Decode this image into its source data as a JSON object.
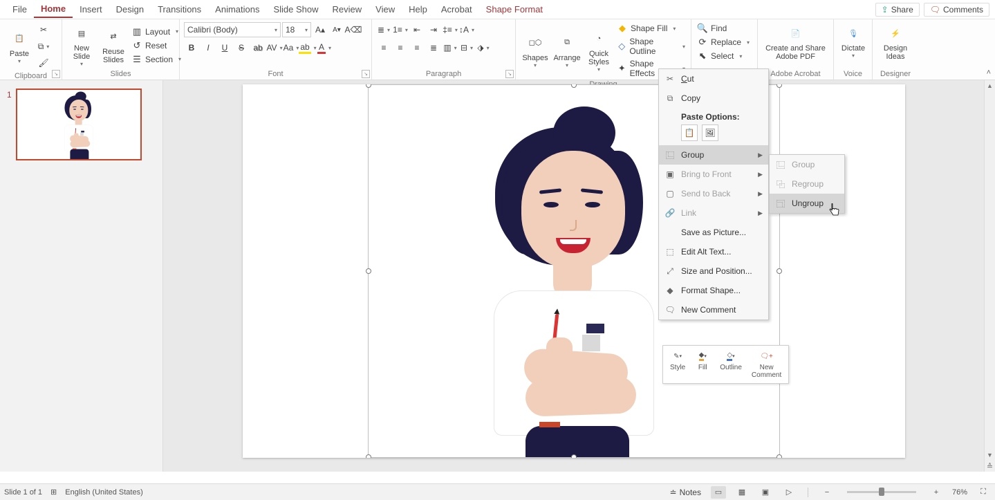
{
  "tabs": {
    "items": [
      "File",
      "Home",
      "Insert",
      "Design",
      "Transitions",
      "Animations",
      "Slide Show",
      "Review",
      "View",
      "Help",
      "Acrobat"
    ],
    "active": "Home",
    "context": "Shape Format"
  },
  "topbuttons": {
    "share": "Share",
    "comments": "Comments"
  },
  "ribbon": {
    "clipboard": {
      "label": "Clipboard",
      "paste": "Paste"
    },
    "slides": {
      "label": "Slides",
      "new": "New\nSlide",
      "reuse": "Reuse\nSlides",
      "layout": "Layout",
      "reset": "Reset",
      "section": "Section"
    },
    "font": {
      "label": "Font",
      "name": "Calibri (Body)",
      "size": "18"
    },
    "paragraph": {
      "label": "Paragraph"
    },
    "drawing": {
      "label": "Drawing",
      "shapes": "Shapes",
      "arrange": "Arrange",
      "quick": "Quick\nStyles",
      "fill": "Shape Fill",
      "outline": "Shape Outline",
      "effects": "Shape Effects"
    },
    "editing": {
      "find": "Find",
      "replace": "Replace",
      "select": "Select"
    },
    "acrobat": {
      "label": "Adobe Acrobat",
      "create": "Create and Share\nAdobe PDF"
    },
    "voice": {
      "label": "Voice",
      "dictate": "Dictate"
    },
    "designer": {
      "label": "Designer",
      "ideas": "Design\nIdeas"
    }
  },
  "thumbs": {
    "num": "1"
  },
  "context_menu": {
    "cut": "Cut",
    "copy": "Copy",
    "paste_hdr": "Paste Options:",
    "group": "Group",
    "bring": "Bring to Front",
    "send": "Send to Back",
    "link": "Link",
    "savepic": "Save as Picture...",
    "alttext": "Edit Alt Text...",
    "sizepos": "Size and Position...",
    "fmt": "Format Shape...",
    "newcom": "New Comment"
  },
  "submenu": {
    "group": "Group",
    "regroup": "Regroup",
    "ungroup": "Ungroup"
  },
  "minibar": {
    "style": "Style",
    "fill": "Fill",
    "outline": "Outline",
    "newcom": "New\nComment"
  },
  "status": {
    "slide": "Slide 1 of 1",
    "lang": "English (United States)",
    "notes": "Notes",
    "zoom": "76%"
  }
}
